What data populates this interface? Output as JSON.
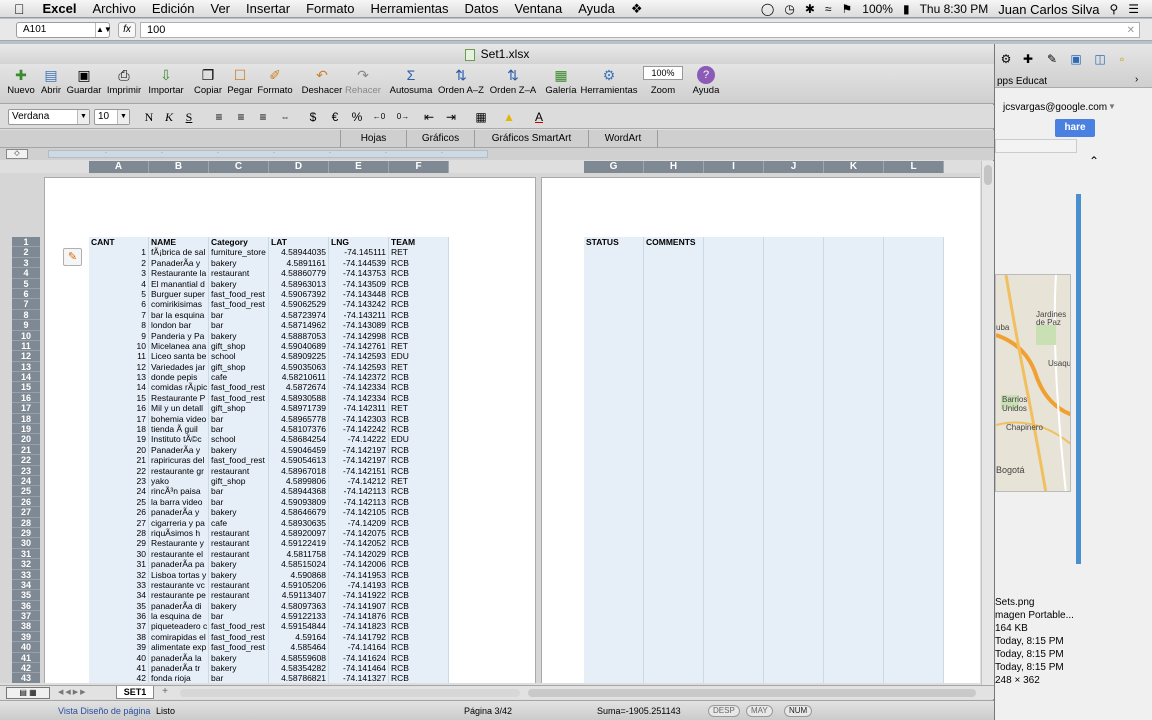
{
  "menubar": {
    "app": "Excel",
    "items": [
      "Archivo",
      "Edición",
      "Ver",
      "Insertar",
      "Formato",
      "Herramientas",
      "Datos",
      "Ventana",
      "Ayuda"
    ],
    "battery": "100%",
    "clock": "Thu 8:30 PM",
    "user": "Juan Carlos Silva"
  },
  "formula": {
    "cell": "A101",
    "fx": "fx",
    "value": "100"
  },
  "window": {
    "title": "Set1.xlsx"
  },
  "toolbar": {
    "items": [
      "Nuevo",
      "Abrir",
      "Guardar",
      "Imprimir",
      "Importar",
      "Copiar",
      "Pegar",
      "Formato",
      "Deshacer",
      "Rehacer",
      "Autosuma",
      "Orden A–Z",
      "Orden Z–A",
      "Galería",
      "Herramientas",
      "Zoom",
      "Ayuda"
    ],
    "zoom_value": "100%"
  },
  "format": {
    "font": "Verdana",
    "size": "10"
  },
  "ribbon": {
    "tabs": [
      "Hojas",
      "Gráficos",
      "Gráficos SmartArt",
      "WordArt"
    ]
  },
  "columns": [
    "A",
    "B",
    "C",
    "D",
    "E",
    "F",
    "G",
    "H",
    "I",
    "J",
    "K",
    "L"
  ],
  "rows": [
    "1",
    "2",
    "3",
    "4",
    "5",
    "6",
    "7",
    "8",
    "9",
    "10",
    "11",
    "12",
    "13",
    "14",
    "15",
    "16",
    "17",
    "18",
    "19",
    "20",
    "21",
    "22",
    "23",
    "24",
    "25",
    "26",
    "27",
    "28",
    "29",
    "30",
    "31",
    "32",
    "33",
    "34",
    "35",
    "36",
    "37",
    "38",
    "39",
    "40",
    "41",
    "42",
    "43"
  ],
  "sheet": {
    "headers": [
      "CANT",
      "NAME",
      "Category",
      "LAT",
      "LNG",
      "TEAM"
    ],
    "rows": [
      [
        "1",
        "fÃ¡brica de sal",
        "furniture_store",
        "4.58944035",
        "-74.145111",
        "RET"
      ],
      [
        "2",
        "PanaderÃ­a y",
        "bakery",
        "4.5891161",
        "-74.144539",
        "RCB"
      ],
      [
        "3",
        "Restaurante la",
        "restaurant",
        "4.58860779",
        "-74.143753",
        "RCB"
      ],
      [
        "4",
        "El manantial d",
        "bakery",
        "4.58963013",
        "-74.143509",
        "RCB"
      ],
      [
        "5",
        "Burguer super",
        "fast_food_rest",
        "4.59067392",
        "-74.143448",
        "RCB"
      ],
      [
        "6",
        "comirikisimas",
        "fast_food_rest",
        "4.59062529",
        "-74.143242",
        "RCB"
      ],
      [
        "7",
        "bar la esquina",
        "bar",
        "4.58723974",
        "-74.143211",
        "RCB"
      ],
      [
        "8",
        "london bar",
        "bar",
        "4.58714962",
        "-74.143089",
        "RCB"
      ],
      [
        "9",
        "Panderia y Pa",
        "bakery",
        "4.58887053",
        "-74.142998",
        "RCB"
      ],
      [
        "10",
        "Micelanea ana",
        "gift_shop",
        "4.59040689",
        "-74.142761",
        "RET"
      ],
      [
        "11",
        "Liceo santa be",
        "school",
        "4.58909225",
        "-74.142593",
        "EDU"
      ],
      [
        "12",
        "Variedades jar",
        "gift_shop",
        "4.59035063",
        "-74.142593",
        "RET"
      ],
      [
        "13",
        "donde pepis",
        "cafe",
        "4.58210611",
        "-74.142372",
        "RCB"
      ],
      [
        "14",
        "comidas rÃ¡pic",
        "fast_food_rest",
        "4.5872674",
        "-74.142334",
        "RCB"
      ],
      [
        "15",
        "Restaurante P",
        "fast_food_rest",
        "4.58930588",
        "-74.142334",
        "RCB"
      ],
      [
        "16",
        "Mil y un detall",
        "gift_shop",
        "4.58971739",
        "-74.142311",
        "RET"
      ],
      [
        "17",
        "bohemia video",
        "bar",
        "4.58965778",
        "-74.142303",
        "RCB"
      ],
      [
        "18",
        "tienda Ã  guil",
        "bar",
        "4.58107376",
        "-74.142242",
        "RCB"
      ],
      [
        "19",
        "Instituto tÃ©c",
        "school",
        "4.58684254",
        "-74.14222",
        "EDU"
      ],
      [
        "20",
        "PanaderÃ­a y",
        "bakery",
        "4.59046459",
        "-74.142197",
        "RCB"
      ],
      [
        "21",
        "rapiricuras del",
        "fast_food_rest",
        "4.59054613",
        "-74.142197",
        "RCB"
      ],
      [
        "22",
        "restaurante gr",
        "restaurant",
        "4.58967018",
        "-74.142151",
        "RCB"
      ],
      [
        "23",
        "yako",
        "gift_shop",
        "4.5899806",
        "-74.14212",
        "RET"
      ],
      [
        "24",
        "rincÃ³n paisa",
        "bar",
        "4.58944368",
        "-74.142113",
        "RCB"
      ],
      [
        "25",
        "la barra video",
        "bar",
        "4.59093809",
        "-74.142113",
        "RCB"
      ],
      [
        "26",
        "panaderÃ­a y",
        "bakery",
        "4.58646679",
        "-74.142105",
        "RCB"
      ],
      [
        "27",
        "cigarreria y pa",
        "cafe",
        "4.58930635",
        "-74.14209",
        "RCB"
      ],
      [
        "28",
        "riquÃ­simos h",
        "restaurant",
        "4.58920097",
        "-74.142075",
        "RCB"
      ],
      [
        "29",
        "Restaurante y",
        "restaurant",
        "4.59122419",
        "-74.142052",
        "RCB"
      ],
      [
        "30",
        "restaurante el",
        "restaurant",
        "4.5811758",
        "-74.142029",
        "RCB"
      ],
      [
        "31",
        "panaderÃ­a pa",
        "bakery",
        "4.58515024",
        "-74.142006",
        "RCB"
      ],
      [
        "32",
        "Lisboa tortas y",
        "bakery",
        "4.590868",
        "-74.141953",
        "RCB"
      ],
      [
        "33",
        "restaurante vc",
        "restaurant",
        "4.59105206",
        "-74.14193",
        "RCB"
      ],
      [
        "34",
        "restaurante pe",
        "restaurant",
        "4.59113407",
        "-74.141922",
        "RCB"
      ],
      [
        "35",
        "panaderÃ­a di",
        "bakery",
        "4.58097363",
        "-74.141907",
        "RCB"
      ],
      [
        "36",
        "la esquina de",
        "bar",
        "4.59122133",
        "-74.141876",
        "RCB"
      ],
      [
        "37",
        "piqueteadero c",
        "fast_food_rest",
        "4.59154844",
        "-74.141823",
        "RCB"
      ],
      [
        "38",
        "comirapidas el",
        "fast_food_rest",
        "4.59164",
        "-74.141792",
        "RCB"
      ],
      [
        "39",
        "alimentate exp",
        "fast_food_rest",
        "4.585464",
        "-74.14164",
        "RCB"
      ],
      [
        "40",
        "panaderÃ­a la",
        "bakery",
        "4.58559608",
        "-74.141624",
        "RCB"
      ],
      [
        "41",
        "panaderÃ­a tr",
        "bakery",
        "4.58354282",
        "-74.141464",
        "RCB"
      ],
      [
        "42",
        "fonda rioja",
        "bar",
        "4.58786821",
        "-74.141327",
        "RCB"
      ]
    ],
    "extra_headers": [
      "STATUS",
      "COMMENTS"
    ]
  },
  "tabs": {
    "sheet_name": "SET1"
  },
  "status": {
    "view": "Vista Diseño de página",
    "ready": "Listo",
    "page": "Página 3/42",
    "sum": "Suma=-1905.251143",
    "desp": "DESP",
    "may": "MAY",
    "num": "NUM"
  },
  "bg": {
    "apps": "pps Educat",
    "account": "jcsvargas@google.com",
    "share": "hare",
    "map_labels": [
      "uba",
      "Jardines de Paz",
      "Usaqu",
      "Barrios Unidos",
      "Chapinero",
      "Bogotá"
    ],
    "file_name": "Sets.png",
    "file_type": "magen Portable...",
    "file_size": "164 KB",
    "created": "Today, 8:15 PM",
    "modified": "Today, 8:15 PM",
    "opened": "Today, 8:15 PM",
    "dims": "248 × 362"
  }
}
